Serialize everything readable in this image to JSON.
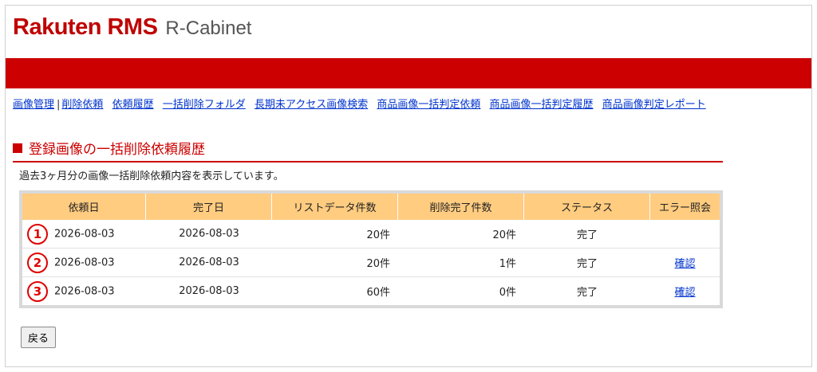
{
  "header": {
    "brand": "Rakuten RMS",
    "sub": "R-Cabinet",
    "accent_color": "#cc0000"
  },
  "nav": [
    {
      "label": "画像管理"
    },
    {
      "label": "削除依頼"
    },
    {
      "label": "依頼履歴"
    },
    {
      "label": "一括削除フォルダ"
    },
    {
      "label": "長期未アクセス画像検索"
    },
    {
      "label": "商品画像一括判定依頼"
    },
    {
      "label": "商品画像一括判定履歴"
    },
    {
      "label": "商品画像判定レポート"
    }
  ],
  "nav_separator": "|",
  "section": {
    "title": "登録画像の一括削除依頼履歴",
    "description": "過去3ヶ月分の画像一括削除依頼内容を表示しています。"
  },
  "table": {
    "headers": [
      "依頼日",
      "完了日",
      "リストデータ件数",
      "削除完了件数",
      "ステータス",
      "エラー照会"
    ],
    "rows": [
      {
        "marker": "1",
        "request_date": "2026-08-03",
        "complete_date": "2026-08-03",
        "list_count": "20件",
        "deleted_count": "20件",
        "status": "完了",
        "error_link": ""
      },
      {
        "marker": "2",
        "request_date": "2026-08-03",
        "complete_date": "2026-08-03",
        "list_count": "20件",
        "deleted_count": "1件",
        "status": "完了",
        "error_link": "確認"
      },
      {
        "marker": "3",
        "request_date": "2026-08-03",
        "complete_date": "2026-08-03",
        "list_count": "60件",
        "deleted_count": "0件",
        "status": "完了",
        "error_link": "確認"
      }
    ]
  },
  "back_button": "戻る"
}
